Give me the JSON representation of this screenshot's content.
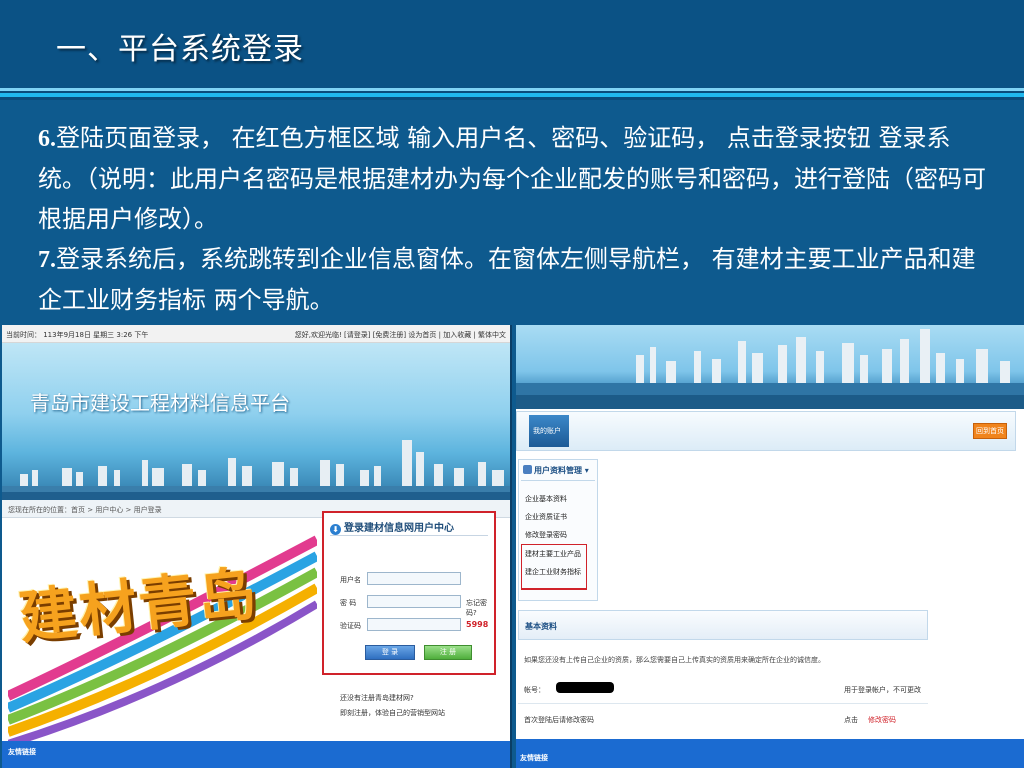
{
  "slide": {
    "title": "一、平台系统登录",
    "step6_num": "6.",
    "step6_text": "登陆页面登录， 在红色方框区域 输入用户名、密码、验证码， 点击登录按钮 登录系统。（说明：此用户名密码是根据建材办为每个企业配发的账号和密码，进行登陆（密码可根据用户修改）。",
    "step7_num": "7.",
    "step7_text": "登录系统后，系统跳转到企业信息窗体。在窗体左侧导航栏， 有建材主要工业产品和建企工业财务指标 两个导航。"
  },
  "login_page": {
    "current_time": "当前时间： 113年9月18日 星期三 3:26 下午",
    "top_links": "您好,欢迎光临! [请登录] [免费注册] 设为首页 | 加入收藏 | 繁体中文",
    "site_title": "青岛市建设工程材料信息平台",
    "breadcrumb": "您现在所在的位置：首页 > 用户中心 > 用户登录",
    "promo_text": "建材青岛",
    "login_title": "登录建材信息网用户中心",
    "username_label": "用户名",
    "password_label": "密 码",
    "forgot_password": "忘记密码?",
    "captcha_label": "验证码",
    "captcha_code": "5998",
    "login_button": "登 录",
    "register_button": "注 册",
    "register_hint": "还没有注册青岛建材网?",
    "register_hint2": "即刻注册，体验自己的营销型网站",
    "footer": "友情链接"
  },
  "member_page": {
    "account_tab": "我的账户",
    "home_button": "回到首页",
    "nav_header": "用户资料管理",
    "nav_items": [
      "企业基本资料",
      "企业资质证书",
      "修改登录密码",
      "建材主要工业产品",
      "建企工业财务指标"
    ],
    "info_header": "基本资料",
    "info_note": "如果您还没有上传自己企业的资质，那么您需要自己上传真实的资质用来确定所在企业的诚信度。",
    "account_label": "帐号：",
    "account_hint": "用于登录帐户，不可更改",
    "first_login_label": "首次登陆后请修改密码",
    "click_label": "点击",
    "change_password_link": "修改密码",
    "footer": "友情链接"
  },
  "colors": {
    "slide_bg": "#0e5a8e",
    "title_bar": "#0b5285",
    "highlight_red": "#d0222a",
    "footer_blue": "#1b6bd1"
  }
}
